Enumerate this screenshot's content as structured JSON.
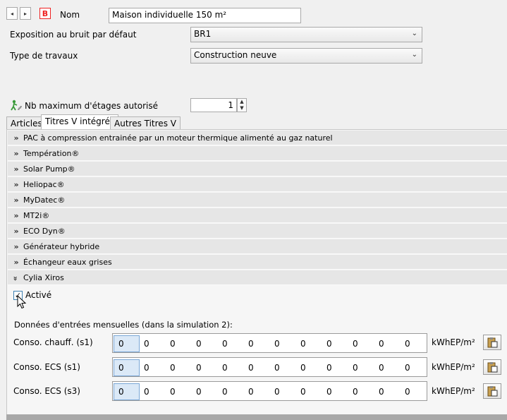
{
  "header": {
    "nav_prev": "◂",
    "nav_next": "▸",
    "b_icon_letter": "B",
    "name_label": "Nom",
    "name_value": "Maison individuelle 150 m²"
  },
  "fields": {
    "noise_label": "Exposition au bruit par défaut",
    "noise_value": "BR1",
    "works_label": "Type de travaux",
    "works_value": "Construction neuve",
    "floors_label": "Nb maximum d'étages autorisé",
    "floors_value": "1"
  },
  "tabs": [
    "Articles",
    "Titres V intégrés",
    "Autres Titres V"
  ],
  "accordion": [
    "PAC à compression entrainée par un moteur thermique alimenté au gaz naturel",
    "Températion®",
    "Solar Pump®",
    "Heliopac®",
    "MyDatec®",
    "MT2i®",
    "ECO Dyn®",
    "Générateur hybride",
    "Échangeur eaux grises",
    "Cylia Xiros"
  ],
  "expanded": {
    "checkbox_label": "Activé",
    "checked": true,
    "section_title": "Données d'entrées mensuelles (dans la simulation 2):",
    "unit": "kWhEP/m²",
    "rows": [
      {
        "label": "Conso. chauff. (s1)",
        "values": [
          "0",
          "0",
          "0",
          "0",
          "0",
          "0",
          "0",
          "0",
          "0",
          "0",
          "0",
          "0"
        ]
      },
      {
        "label": "Conso. ECS (s1)",
        "values": [
          "0",
          "0",
          "0",
          "0",
          "0",
          "0",
          "0",
          "0",
          "0",
          "0",
          "0",
          "0"
        ]
      },
      {
        "label": "Conso. ECS (s3)",
        "values": [
          "0",
          "0",
          "0",
          "0",
          "0",
          "0",
          "0",
          "0",
          "0",
          "0",
          "0",
          "0"
        ]
      }
    ]
  },
  "icons": {
    "nav": "arrow-icons",
    "b": "b-icon",
    "floors": "person-stairs-icon",
    "paste": "clipboard-paste-icon"
  }
}
